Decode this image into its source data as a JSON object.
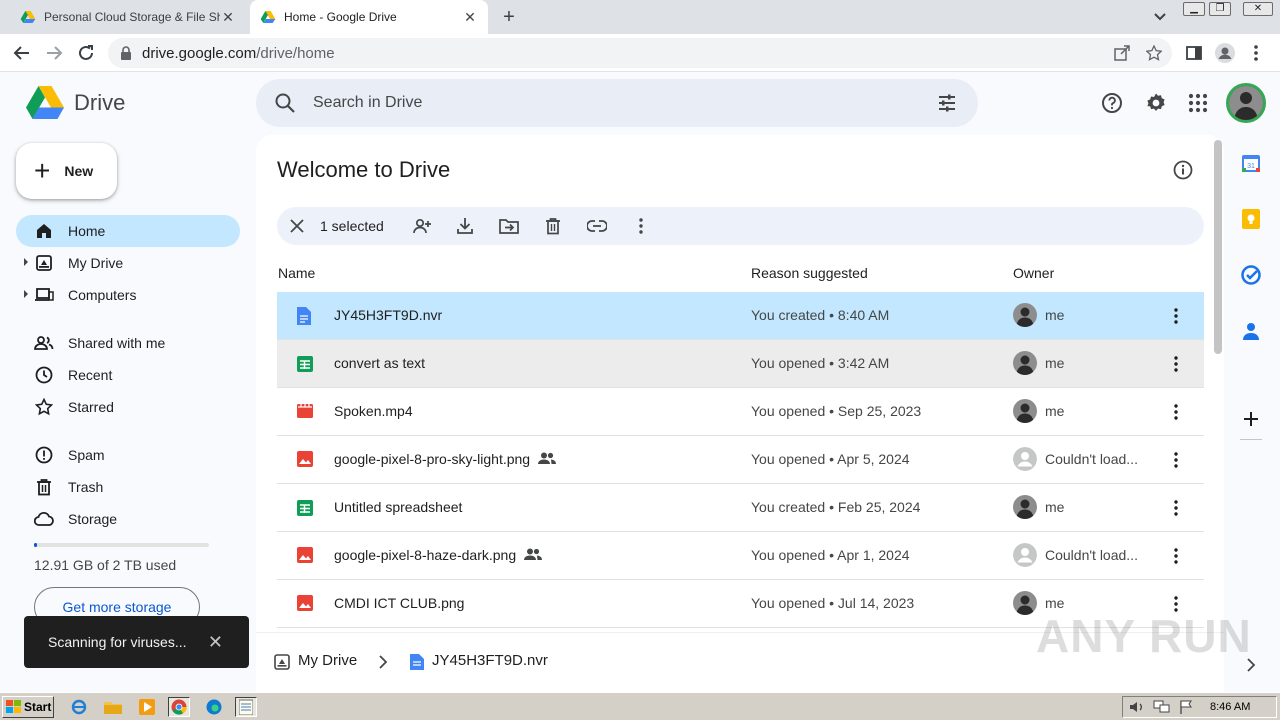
{
  "browser": {
    "tabs": [
      {
        "label": "Personal Cloud Storage & File Sharin",
        "active": false
      },
      {
        "label": "Home - Google Drive",
        "active": true
      }
    ],
    "url": {
      "domain": "drive.google.com",
      "path": "/drive/home"
    }
  },
  "app": {
    "name": "Drive",
    "search_placeholder": "Search in Drive",
    "new_button": "New",
    "nav": [
      {
        "label": "Home",
        "icon": "home-icon",
        "active": true
      },
      {
        "label": "My Drive",
        "icon": "my-drive-icon",
        "expandable": true
      },
      {
        "label": "Computers",
        "icon": "computer-icon",
        "expandable": true
      },
      {
        "label": "Shared with me",
        "icon": "people-icon"
      },
      {
        "label": "Recent",
        "icon": "clock-icon"
      },
      {
        "label": "Starred",
        "icon": "star-icon"
      },
      {
        "label": "Spam",
        "icon": "spam-icon"
      },
      {
        "label": "Trash",
        "icon": "trash-icon"
      },
      {
        "label": "Storage",
        "icon": "cloud-icon"
      }
    ],
    "storage": {
      "text": "12.91 GB of 2 TB used",
      "used_fraction": 0.0065,
      "button": "Get more storage"
    },
    "toast": {
      "text": "Scanning for viruses..."
    }
  },
  "main": {
    "title": "Welcome to Drive",
    "selection": {
      "text": "1 selected"
    },
    "columns": {
      "name": "Name",
      "reason": "Reason suggested",
      "owner": "Owner"
    },
    "files": [
      {
        "name": "JY45H3FT9D.nvr",
        "type": "doc",
        "reason": "You created • 8:40 AM",
        "owner": "me",
        "owner_known": true,
        "shared": false,
        "state": "selected"
      },
      {
        "name": "convert as text",
        "type": "sheet",
        "reason": "You opened • 3:42 AM",
        "owner": "me",
        "owner_known": true,
        "shared": false,
        "state": "hovered"
      },
      {
        "name": "Spoken.mp4",
        "type": "video",
        "reason": "You opened • Sep 25, 2023",
        "owner": "me",
        "owner_known": true,
        "shared": false,
        "state": ""
      },
      {
        "name": "google-pixel-8-pro-sky-light.png",
        "type": "image",
        "reason": "You opened • Apr 5, 2024",
        "owner": "Couldn't load...",
        "owner_known": false,
        "shared": true,
        "state": ""
      },
      {
        "name": "Untitled spreadsheet",
        "type": "sheet",
        "reason": "You created • Feb 25, 2024",
        "owner": "me",
        "owner_known": true,
        "shared": false,
        "state": ""
      },
      {
        "name": "google-pixel-8-haze-dark.png",
        "type": "image",
        "reason": "You opened • Apr 1, 2024",
        "owner": "Couldn't load...",
        "owner_known": false,
        "shared": true,
        "state": ""
      },
      {
        "name": "CMDI ICT CLUB.png",
        "type": "image",
        "reason": "You opened • Jul 14, 2023",
        "owner": "me",
        "owner_known": true,
        "shared": false,
        "state": ""
      }
    ],
    "breadcrumb": {
      "root": "My Drive",
      "current": "JY45H3FT9D.nvr"
    }
  },
  "watermark": "ANY RUN",
  "taskbar": {
    "start": "Start",
    "clock": "8:46 AM"
  },
  "colors": {
    "accent_blue": "#0b57d0",
    "selected_row": "#c2e7ff",
    "doc_blue": "#4285f4",
    "sheet_green": "#0f9d58",
    "image_red": "#ea4335"
  }
}
